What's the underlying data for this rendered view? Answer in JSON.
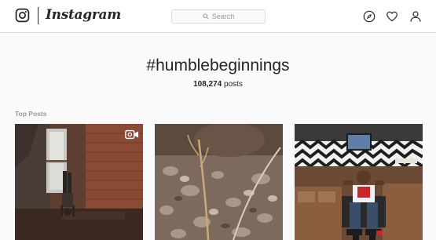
{
  "header": {
    "wordmark": "Instagram",
    "search_placeholder": "Search",
    "icons": [
      "instagram-glyph-icon",
      "search-icon",
      "compass-icon",
      "heart-icon",
      "profile-icon"
    ]
  },
  "hashtag_page": {
    "title": "#humblebeginnings",
    "post_count_number": "108,274",
    "post_count_suffix": " posts",
    "section_label": "Top Posts"
  },
  "top_posts": [
    {
      "media_type": "video",
      "badge_icon": "video-icon"
    },
    {
      "media_type": "photo"
    },
    {
      "media_type": "photo"
    }
  ],
  "colors": {
    "background": "#fafafa",
    "text_primary": "#262626",
    "text_secondary": "#999999",
    "border": "#dbdbdb"
  }
}
